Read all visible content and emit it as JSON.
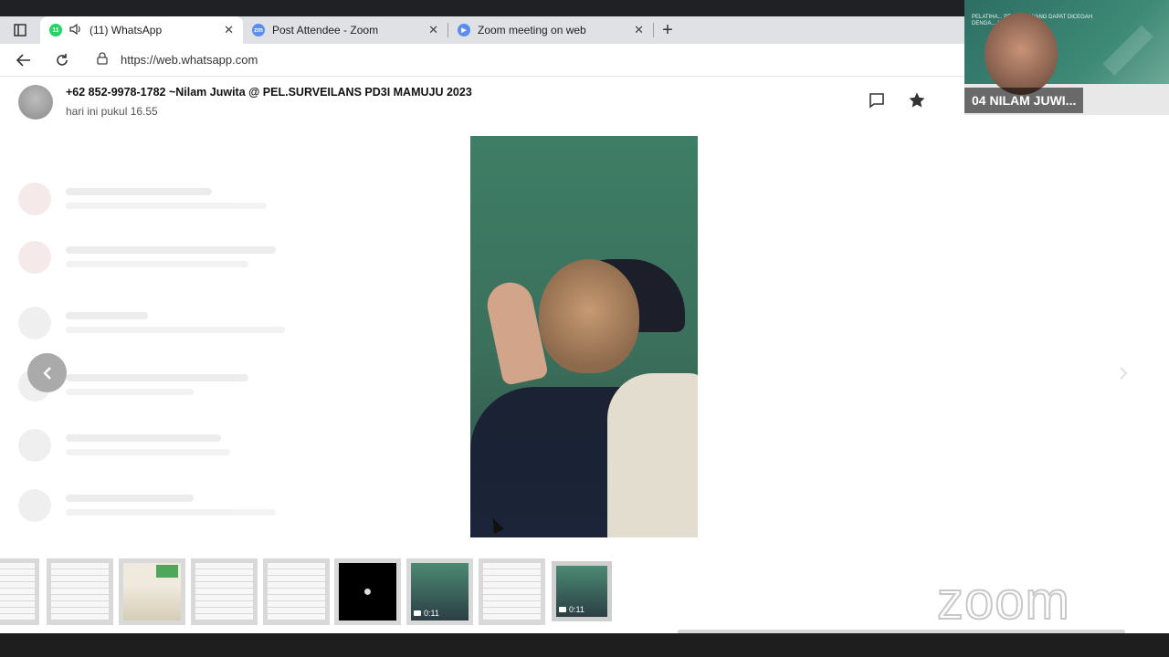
{
  "browser": {
    "tabs": [
      {
        "label": "(11) WhatsApp",
        "badge": "11",
        "active": true
      },
      {
        "label": "Post Attendee - Zoom",
        "active": false
      },
      {
        "label": "Zoom meeting on web",
        "active": false
      }
    ],
    "url": "https://web.whatsapp.com"
  },
  "viewer": {
    "sender": "+62 852-9978-1782 ~Nilam Juwita @ PEL.SURVEILANS PD3I MAMUJU 2023",
    "timestamp": "hari ini pukul 16.55"
  },
  "thumbnails": [
    {
      "kind": "doc"
    },
    {
      "kind": "doc"
    },
    {
      "kind": "green"
    },
    {
      "kind": "doc"
    },
    {
      "kind": "doc"
    },
    {
      "kind": "black"
    },
    {
      "kind": "video",
      "duration": "0:11"
    },
    {
      "kind": "doc"
    },
    {
      "kind": "video",
      "duration": "0:11",
      "selected": true
    }
  ],
  "zoom_overlay": {
    "logo_text": "zoom",
    "participant_name": "04 NILAM JUWI...",
    "banner_text": "PELATIHA... PENYAKIT YANG DAPAT DICEGAH DENGA... (PD3I)"
  },
  "colors": {
    "whatsapp_green": "#25d366",
    "zoom_blue": "#5b8def",
    "tabbar_bg": "#dfe1e5"
  }
}
